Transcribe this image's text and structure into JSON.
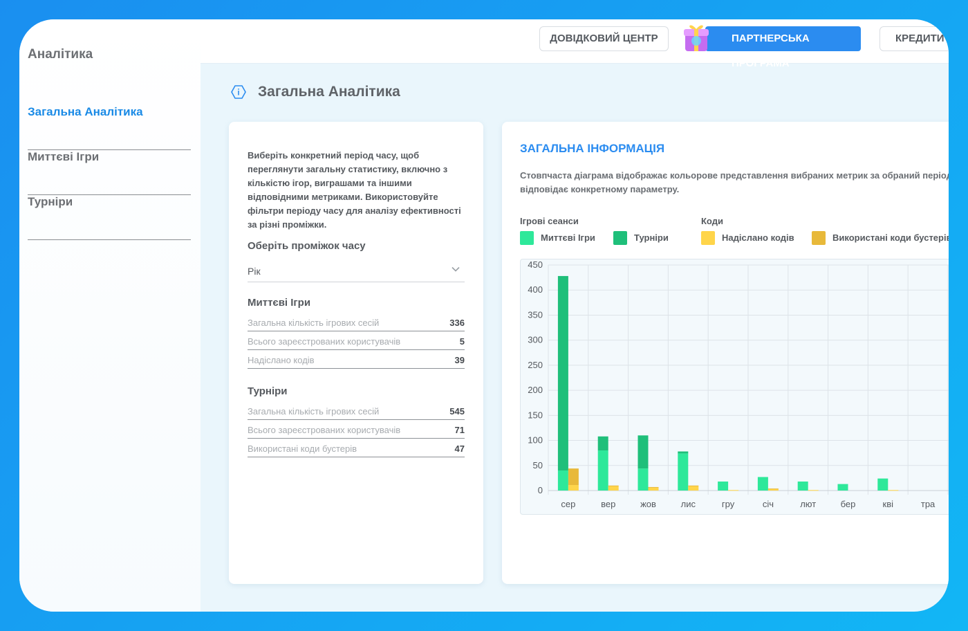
{
  "sidebar": {
    "title": "Аналітика",
    "items": [
      {
        "label": "Загальна Аналітика",
        "active": true
      },
      {
        "label": "Миттєві Ігри",
        "active": false
      },
      {
        "label": "Турніри",
        "active": false
      }
    ]
  },
  "topbar": {
    "help_label": "ДОВІДКОВИЙ ЦЕНТР",
    "partner_label": "ПАРТНЕРСЬКА ПРОГРАМА",
    "credit_label": "КРЕДИТИ",
    "partner_color": "#2b8cf0"
  },
  "page": {
    "title": "Загальна Аналітика",
    "icon": "info-icon"
  },
  "left_card": {
    "description": "Виберіть конкретний період часу, щоб переглянути загальну статистику, включно з кількістю ігор, виграшами та іншими відповідними метриками. Використовуйте фільтри періоду часу для аналізу ефективності за різні проміжки.",
    "period_label": "Оберіть проміжок часу",
    "period_value": "Рік",
    "instant": {
      "title": "Миттєві Ігри",
      "rows": [
        {
          "label": "Загальна кількість ігрових сесій",
          "value": "336"
        },
        {
          "label": "Всього зареєстрованих користувачів",
          "value": "5"
        },
        {
          "label": "Надіслано кодів",
          "value": "39"
        }
      ]
    },
    "tournaments": {
      "title": "Турніри",
      "rows": [
        {
          "label": "Загальна кількість ігрових сесій",
          "value": "545"
        },
        {
          "label": "Всього зареєстрованих користувачів",
          "value": "71"
        },
        {
          "label": "Використані коди бустерів",
          "value": "47"
        }
      ]
    }
  },
  "right_card": {
    "title": "ЗАГАЛЬНА ІНФОРМАЦІЯ",
    "description": "Стовпчаста діаграма відображає кольорове представлення вибраних метрик за обраний період ч відповідає конкретному параметру.",
    "legend": {
      "group1_title": "Ігрові сеанси",
      "group2_title": "Коди",
      "items": [
        {
          "label": "Миттєві Ігри",
          "color": "#2ee89a"
        },
        {
          "label": "Турніри",
          "color": "#1fbf7a"
        },
        {
          "label": "Надіслано кодів",
          "color": "#ffd54a"
        },
        {
          "label": "Використані коди бустерів",
          "color": "#e8b93a"
        }
      ]
    }
  },
  "chart_data": {
    "type": "bar",
    "categories": [
      "сер",
      "вер",
      "жов",
      "лис",
      "гру",
      "січ",
      "лют",
      "бер",
      "кві",
      "тра"
    ],
    "ylim": [
      0,
      450
    ],
    "yticks": [
      0,
      50,
      100,
      150,
      200,
      250,
      300,
      350,
      400,
      450
    ],
    "grid": true,
    "stacks": [
      {
        "series": [
          {
            "name": "Миттєві Ігри",
            "color": "#2ee89a",
            "values": [
              40,
              80,
              44,
              74,
              18,
              27,
              18,
              13,
              24,
              0
            ]
          },
          {
            "name": "Турніри",
            "color": "#1fbf7a",
            "values": [
              388,
              28,
              66,
              4,
              0,
              0,
              0,
              0,
              0,
              0
            ]
          }
        ]
      },
      {
        "series": [
          {
            "name": "Надіслано кодів",
            "color": "#ffd54a",
            "values": [
              11,
              9,
              6,
              9,
              1,
              3,
              1,
              0,
              1,
              0
            ]
          },
          {
            "name": "Використані коди бустерів",
            "color": "#e8b93a",
            "values": [
              33,
              1,
              1,
              1,
              0,
              1,
              0,
              0,
              0,
              0
            ]
          }
        ]
      }
    ]
  }
}
